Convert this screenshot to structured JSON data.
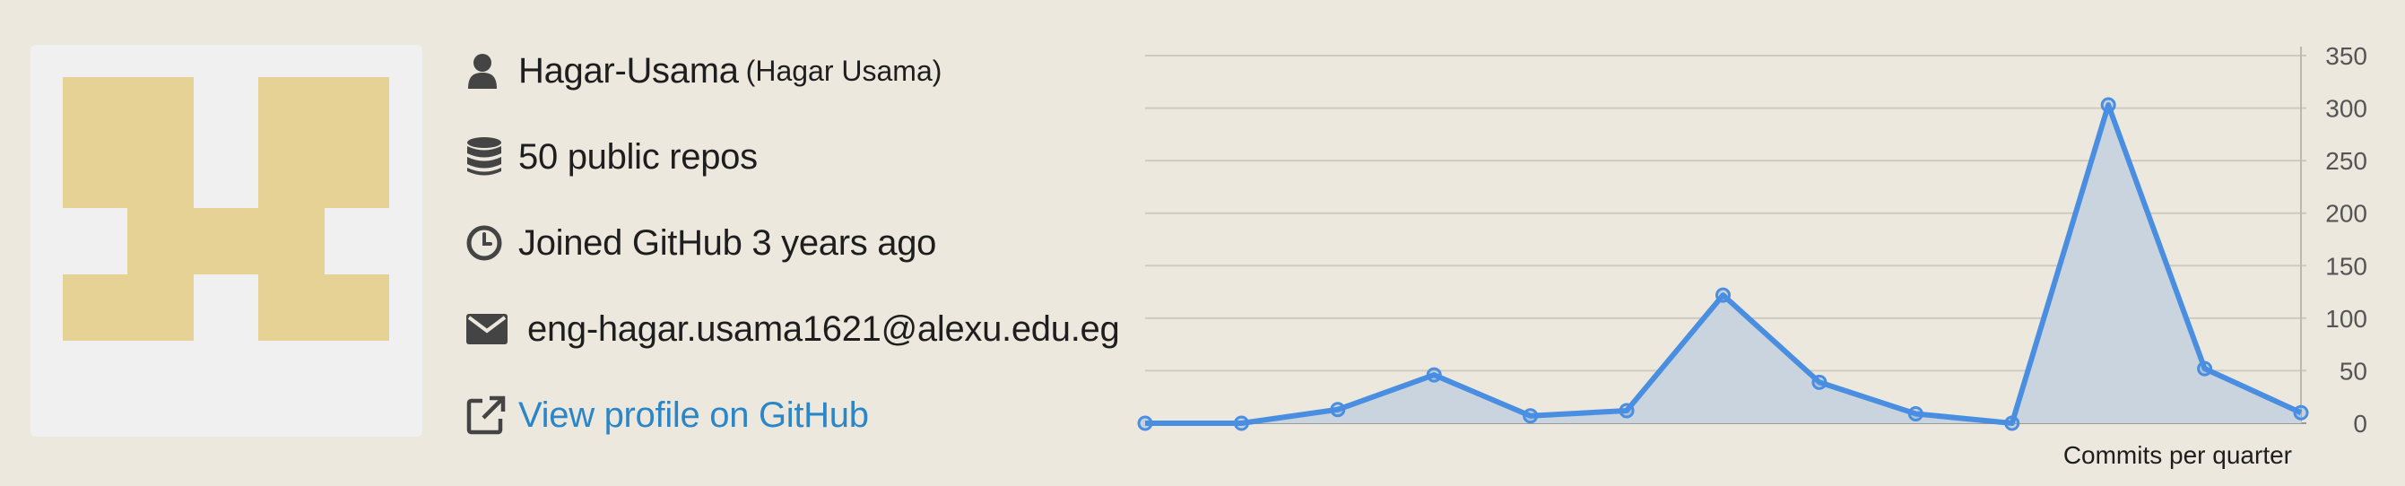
{
  "profile": {
    "username": "Hagar-Usama",
    "display_name": "(Hagar Usama)",
    "repos": "50 public repos",
    "joined": "Joined GitHub 3 years ago",
    "email": "eng-hagar.usama1621@alexu.edu.eg",
    "profile_link": "View profile on GitHub"
  },
  "icons": {
    "user": "user-icon",
    "repos": "database-icon",
    "joined": "clock-icon",
    "email": "envelope-icon",
    "link": "external-link-icon"
  },
  "colors": {
    "background": "#ede8de",
    "avatar_fill": "#e6d295",
    "link": "#2a86c8",
    "series_line": "#4a8ee2",
    "series_fill": "#c9d4de"
  },
  "chart_data": {
    "type": "area",
    "xlabel": "Commits per quarter",
    "ylabel": "",
    "ylim": [
      0,
      350
    ],
    "yticks": [
      "0",
      "50",
      "100",
      "150",
      "200",
      "250",
      "300",
      "350"
    ],
    "grid": true,
    "y_axis_side": "right",
    "values": [
      0,
      0,
      13,
      46,
      7,
      12,
      122,
      39,
      9,
      0,
      303,
      52,
      10
    ]
  }
}
